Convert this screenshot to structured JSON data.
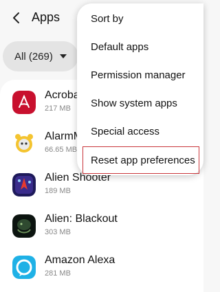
{
  "header": {
    "title": "Apps"
  },
  "filter": {
    "label": "All (269)"
  },
  "apps": [
    {
      "name": "Acrobat",
      "size": "217 MB",
      "icon": "acrobat-icon"
    },
    {
      "name": "AlarmMon",
      "size": "66.65 MB",
      "icon": "alarmmon-icon"
    },
    {
      "name": "Alien Shooter",
      "size": "189 MB",
      "icon": "alien-shooter-icon"
    },
    {
      "name": "Alien: Blackout",
      "size": "303 MB",
      "icon": "alien-blackout-icon"
    },
    {
      "name": "Amazon Alexa",
      "size": "281 MB",
      "icon": "amazon-alexa-icon"
    }
  ],
  "menu": {
    "items": [
      {
        "label": "Sort by"
      },
      {
        "label": "Default apps"
      },
      {
        "label": "Permission manager"
      },
      {
        "label": "Show system apps"
      },
      {
        "label": "Special access"
      },
      {
        "label": "Reset app preferences"
      }
    ],
    "highlight_color": "#c9353a"
  },
  "colors": {
    "background": "#f7f7f7",
    "list_background": "#ffffff",
    "secondary_text": "#888888"
  }
}
